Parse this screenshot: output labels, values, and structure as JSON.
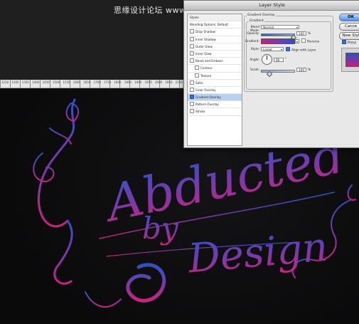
{
  "watermark": "思缘设计论坛 www.MISSYUAN.COM",
  "ruler": {
    "ticks": [
      "1250",
      "1300",
      "1350",
      "1400",
      "1450",
      "1500",
      "1550",
      "1600",
      "1650",
      "1700",
      "1750",
      "1800",
      "1850",
      "1900",
      "1950",
      "2000",
      "2050",
      "2100"
    ]
  },
  "artwork": {
    "line1": "Abducted",
    "line2": "by",
    "line3": "Design",
    "colors": {
      "top": "#2d52c8",
      "mid": "#7a3aa8",
      "bottom": "#d02080"
    }
  },
  "dialog": {
    "title": "Layer Style",
    "styles_panel": {
      "header": "Styles",
      "items": [
        {
          "label": "Blending Options: Default",
          "checkbox": false,
          "checked": false,
          "indent": false
        },
        {
          "label": "Drop Shadow",
          "checkbox": true,
          "checked": false,
          "indent": false
        },
        {
          "label": "Inner Shadow",
          "checkbox": true,
          "checked": false,
          "indent": false
        },
        {
          "label": "Outer Glow",
          "checkbox": true,
          "checked": false,
          "indent": false
        },
        {
          "label": "Inner Glow",
          "checkbox": true,
          "checked": false,
          "indent": false
        },
        {
          "label": "Bevel and Emboss",
          "checkbox": true,
          "checked": false,
          "indent": false
        },
        {
          "label": "Contour",
          "checkbox": true,
          "checked": false,
          "indent": true
        },
        {
          "label": "Texture",
          "checkbox": true,
          "checked": false,
          "indent": true
        },
        {
          "label": "Satin",
          "checkbox": true,
          "checked": false,
          "indent": false
        },
        {
          "label": "Color Overlay",
          "checkbox": true,
          "checked": false,
          "indent": false
        },
        {
          "label": "Gradient Overlay",
          "checkbox": true,
          "checked": true,
          "indent": false
        },
        {
          "label": "Pattern Overlay",
          "checkbox": true,
          "checked": false,
          "indent": false
        },
        {
          "label": "Stroke",
          "checkbox": true,
          "checked": false,
          "indent": false
        }
      ],
      "selected": "Gradient Overlay"
    },
    "gradient_overlay": {
      "group_title": "Gradient Overlay",
      "sub_title": "Gradient",
      "blend_mode_label": "Blend Mode:",
      "blend_mode_value": "Normal",
      "opacity_label": "Opacity:",
      "opacity_value": "100",
      "opacity_unit": "%",
      "gradient_label": "Gradient:",
      "reverse_label": "Reverse",
      "reverse_checked": false,
      "style_label": "Style:",
      "style_value": "Linear",
      "align_label": "Align with Layer",
      "align_checked": true,
      "angle_label": "Angle:",
      "angle_value": "90",
      "angle_unit": "°",
      "scale_label": "Scale:",
      "scale_value": "100",
      "scale_unit": "%",
      "gradient_colors": [
        "#c81e82",
        "#7a3aa8",
        "#2a4fc9"
      ]
    },
    "buttons": {
      "ok": "OK",
      "cancel": "Cance",
      "new_style": "New Styl",
      "preview": "Previ"
    },
    "preview_checked": true
  }
}
